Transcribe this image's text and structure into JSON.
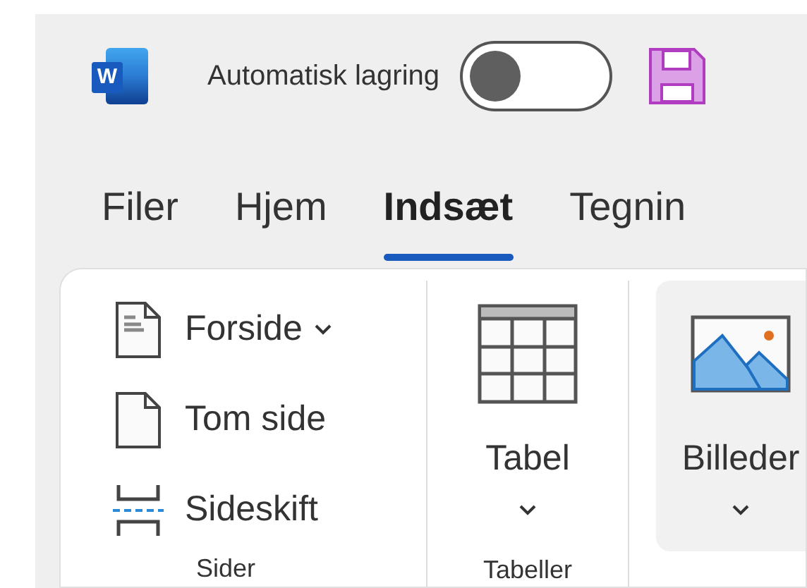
{
  "title_bar": {
    "logo_letter": "W",
    "autosave": {
      "label": "Automatisk lagring",
      "on": false
    }
  },
  "tabs": [
    {
      "label": "Filer",
      "selected": false
    },
    {
      "label": "Hjem",
      "selected": false
    },
    {
      "label": "Indsæt",
      "selected": true
    },
    {
      "label": "Tegnin",
      "selected": false
    }
  ],
  "ribbon": {
    "groups": [
      {
        "label": "Sider",
        "items": [
          {
            "label": "Forside",
            "kind": "dropdown",
            "hovered": false
          },
          {
            "label": "Tom side",
            "kind": "button",
            "hovered": false
          },
          {
            "label": "Sideskift",
            "kind": "button",
            "hovered": false
          }
        ]
      },
      {
        "label": "Tabeller",
        "items": [
          {
            "label": "Tabel",
            "kind": "large",
            "hovered": false
          }
        ]
      },
      {
        "items": [
          {
            "label": "Billeder",
            "kind": "large",
            "hovered": true
          }
        ]
      }
    ]
  }
}
